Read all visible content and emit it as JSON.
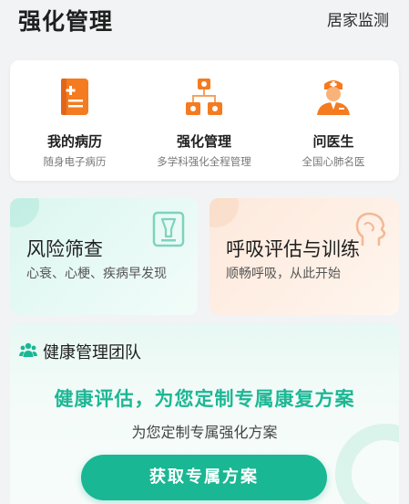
{
  "header": {
    "title": "强化管理",
    "action": "居家监测"
  },
  "quick_links": [
    {
      "name": "我的病历",
      "sub": "随身电子病历",
      "icon": "medical-record-icon"
    },
    {
      "name": "强化管理",
      "sub": "多学科强化全程管理",
      "icon": "organization-chart-icon"
    },
    {
      "name": "问医生",
      "sub": "全国心肺名医",
      "icon": "doctor-icon"
    }
  ],
  "features": {
    "risk": {
      "title": "风险筛查",
      "sub": "心衰、心梗、疾病早发现",
      "icon": "screening-cup-icon"
    },
    "breath": {
      "title": "呼吸评估与训练",
      "sub": "顺畅呼吸，从此开始",
      "icon": "head-profile-icon"
    }
  },
  "team": {
    "title": "健康管理团队",
    "slogan": "健康评估，为您定制专属康复方案",
    "sub": "为您定制专属强化方案",
    "cta": "获取专属方案",
    "icon": "team-icon"
  },
  "colors": {
    "accent": "#19b793",
    "orange": "#f5821f",
    "slogan": "#1db795"
  }
}
